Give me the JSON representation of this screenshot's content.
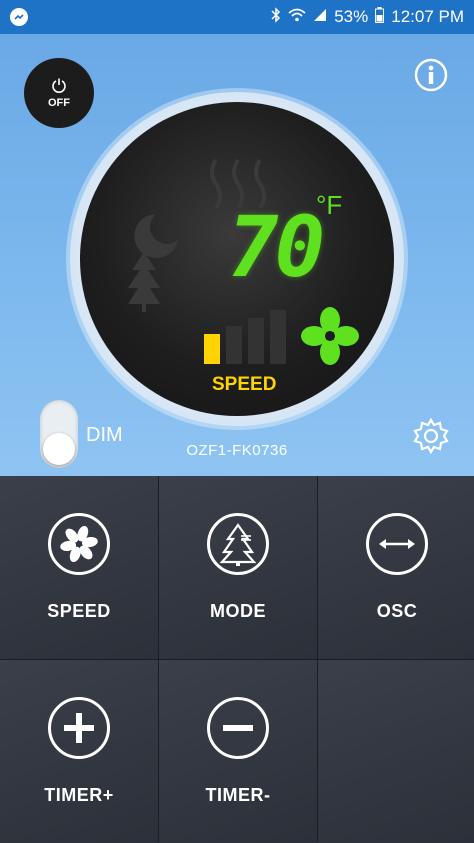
{
  "status_bar": {
    "battery": "53%",
    "time": "12:07 PM"
  },
  "power": {
    "label": "OFF"
  },
  "display": {
    "temperature": "70",
    "unit": "°F",
    "speed_label": "SPEED",
    "speed_level": 1,
    "speed_levels_total": 4
  },
  "dim": {
    "label": "DIM",
    "state": "off"
  },
  "device": {
    "id": "OZF1-FK0736"
  },
  "controls": [
    {
      "label": "SPEED",
      "icon": "fan-icon"
    },
    {
      "label": "MODE",
      "icon": "tree-icon"
    },
    {
      "label": "OSC",
      "icon": "double-arrow-icon"
    },
    {
      "label": "TIMER+",
      "icon": "plus-icon"
    },
    {
      "label": "TIMER-",
      "icon": "minus-icon"
    }
  ],
  "colors": {
    "status_bar": "#1f73c7",
    "panel": "#7db8ee",
    "digits": "#5fe11f",
    "speed": "#ffd400",
    "grid": "#32363f"
  }
}
